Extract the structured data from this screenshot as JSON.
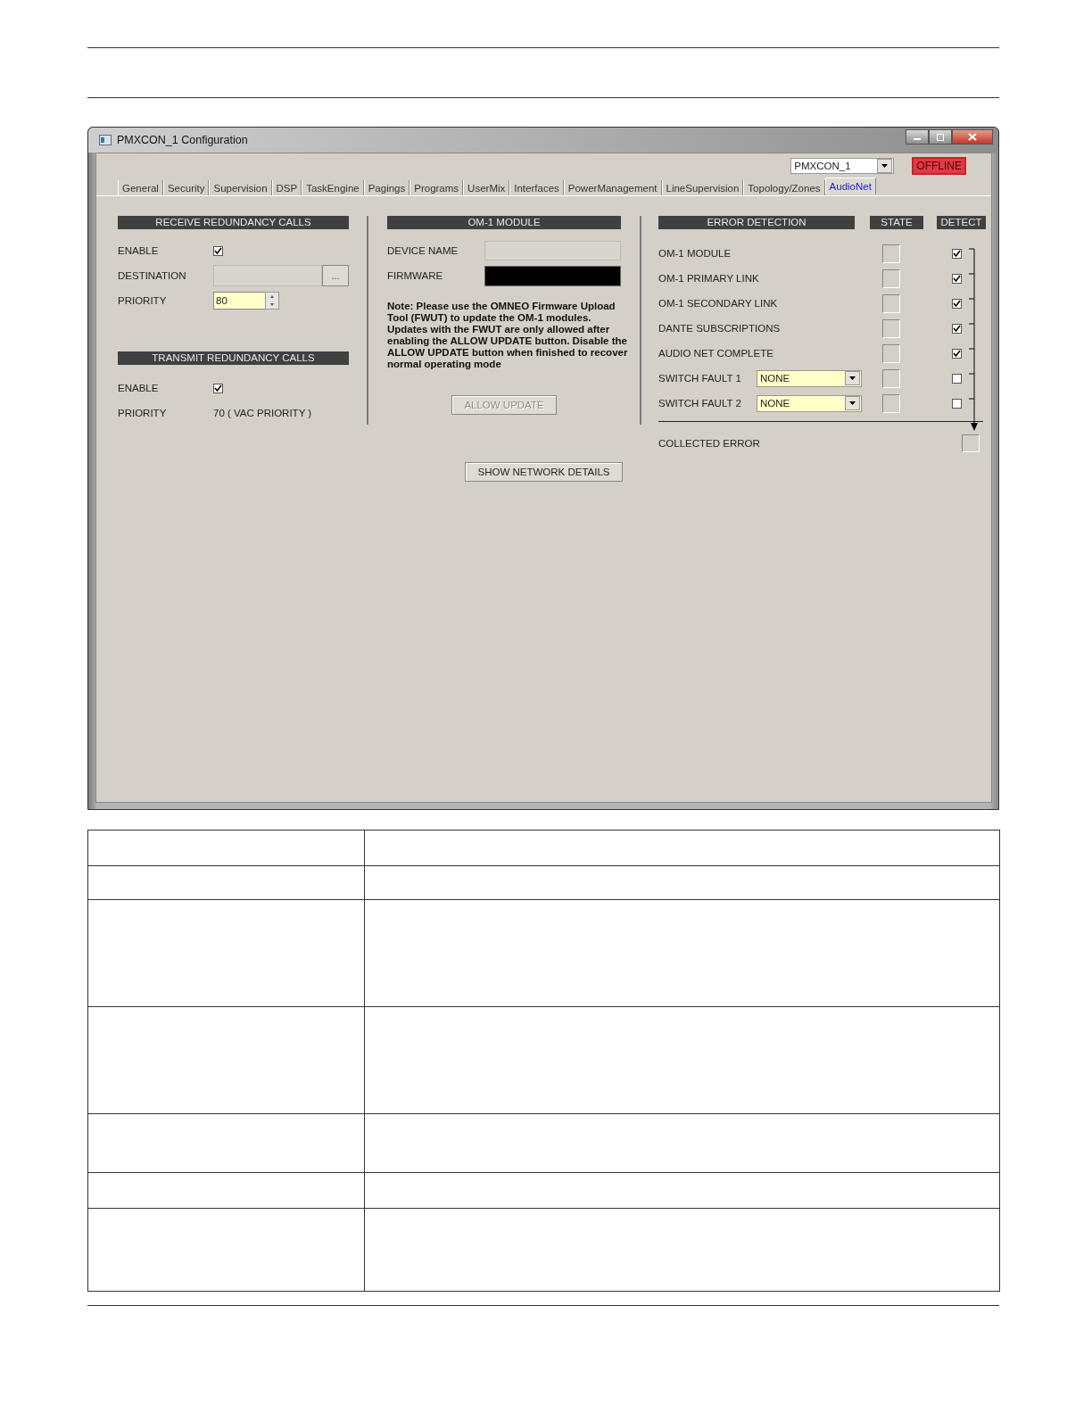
{
  "window": {
    "title": "PMXCON_1 Configuration"
  },
  "device_select": {
    "value": "PMXCON_1"
  },
  "status": {
    "text": "OFFLINE"
  },
  "tabs": [
    {
      "label": "General",
      "selected": false
    },
    {
      "label": "Security",
      "selected": false
    },
    {
      "label": "Supervision",
      "selected": false
    },
    {
      "label": "DSP",
      "selected": false
    },
    {
      "label": "TaskEngine",
      "selected": false
    },
    {
      "label": "Pagings",
      "selected": false
    },
    {
      "label": "Programs",
      "selected": false
    },
    {
      "label": "UserMix",
      "selected": false
    },
    {
      "label": "Interfaces",
      "selected": false
    },
    {
      "label": "PowerManagement",
      "selected": false
    },
    {
      "label": "LineSupervision",
      "selected": false
    },
    {
      "label": "Topology/Zones",
      "selected": false
    },
    {
      "label": "AudioNet",
      "selected": true
    }
  ],
  "receive": {
    "header": "RECEIVE REDUNDANCY CALLS",
    "enable_label": "ENABLE",
    "enable_checked": true,
    "destination_label": "DESTINATION",
    "browse_button": "...",
    "priority_label": "PRIORITY",
    "priority_value": "80"
  },
  "transmit": {
    "header": "TRANSMIT REDUNDANCY CALLS",
    "enable_label": "ENABLE",
    "enable_checked": true,
    "priority_label": "PRIORITY",
    "priority_value": "70  ( VAC PRIORITY )"
  },
  "om1": {
    "header": "OM-1 MODULE",
    "device_name_label": "DEVICE NAME",
    "firmware_label": "FIRMWARE",
    "note": "Note: Please use the OMNEO Firmware Upload Tool (FWUT) to update the OM-1 modules. Updates with the FWUT are only allowed after enabling the ALLOW UPDATE button. Disable the ALLOW UPDATE button when finished to recover normal operating mode",
    "allow_update_button": "ALLOW UPDATE",
    "allow_update_disabled": true
  },
  "error_detection": {
    "header": "ERROR DETECTION",
    "state_header": "STATE",
    "detect_header": "DETECT",
    "rows": [
      {
        "label": "OM-1 MODULE",
        "kind": "plain",
        "state_on": false,
        "detect": true
      },
      {
        "label": "OM-1 PRIMARY LINK",
        "kind": "plain",
        "state_on": false,
        "detect": true
      },
      {
        "label": "OM-1 SECONDARY LINK",
        "kind": "plain",
        "state_on": false,
        "detect": true
      },
      {
        "label": "DANTE SUBSCRIPTIONS",
        "kind": "plain",
        "state_on": false,
        "detect": true
      },
      {
        "label": "AUDIO NET COMPLETE",
        "kind": "plain",
        "state_on": false,
        "detect": true
      },
      {
        "label": "SWITCH FAULT 1",
        "kind": "select",
        "value": "NONE",
        "state_on": false,
        "detect": false
      },
      {
        "label": "SWITCH FAULT 2",
        "kind": "select",
        "value": "NONE",
        "state_on": false,
        "detect": false
      }
    ],
    "collected_label": "COLLECTED ERROR",
    "collected_on": false
  },
  "show_network_button": "SHOW NETWORK DETAILS"
}
